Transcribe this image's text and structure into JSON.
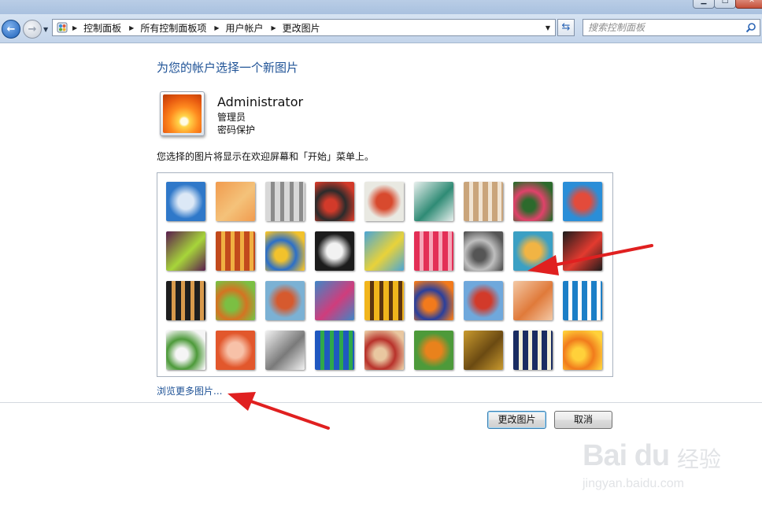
{
  "window": {
    "min_glyph": "▁",
    "max_glyph": "□",
    "close_glyph": "✕"
  },
  "nav": {
    "back_glyph": "←",
    "forward_glyph": "→",
    "recent_glyph": "▼",
    "separator": "▶",
    "breadcrumbs": [
      "控制面板",
      "所有控制面板项",
      "用户帐户",
      "更改图片"
    ],
    "address_dropdown_glyph": "▼",
    "refresh_glyph": "⇆",
    "search_placeholder": "搜索控制面板"
  },
  "main": {
    "title": "为您的帐户选择一个新图片",
    "account": {
      "name": "Administrator",
      "type": "管理员",
      "password_status": "密码保护"
    },
    "description": "您选择的图片将显示在欢迎屏幕和「开始」菜单上。",
    "pictures": [
      {
        "name": "ferris-wheel",
        "colors": [
          "#2f78c9",
          "#dce8f6"
        ]
      },
      {
        "name": "starfish",
        "colors": [
          "#f19b4e",
          "#f4c27a"
        ]
      },
      {
        "name": "robot-toy",
        "colors": [
          "#d8d8d8",
          "#8c8c8c"
        ]
      },
      {
        "name": "record-player",
        "colors": [
          "#2b2b2b",
          "#d23a2a"
        ]
      },
      {
        "name": "lucky-cat",
        "colors": [
          "#e9e9e2",
          "#d84a2e"
        ]
      },
      {
        "name": "gyroscope",
        "colors": [
          "#e9f0ee",
          "#2f8b75"
        ]
      },
      {
        "name": "kitten",
        "colors": [
          "#caa57b",
          "#f1e4d2"
        ]
      },
      {
        "name": "pink-flower",
        "colors": [
          "#e0426a",
          "#2c6a2c"
        ]
      },
      {
        "name": "pinwheel",
        "colors": [
          "#2a8ed8",
          "#e34b3b"
        ]
      },
      {
        "name": "ball",
        "colors": [
          "#5a1d4e",
          "#a7d53a"
        ]
      },
      {
        "name": "woven-fabric",
        "colors": [
          "#c24a1c",
          "#f0b042"
        ]
      },
      {
        "name": "leaf",
        "colors": [
          "#2c6fc7",
          "#f2c22c"
        ]
      },
      {
        "name": "dog",
        "colors": [
          "#1c1c1c",
          "#f2f2f2"
        ]
      },
      {
        "name": "crayons",
        "colors": [
          "#4aa6d6",
          "#e8d23a"
        ]
      },
      {
        "name": "paper-star",
        "colors": [
          "#e32f56",
          "#f6a6b8"
        ]
      },
      {
        "name": "jacks",
        "colors": [
          "#bfbfbf",
          "#555555"
        ]
      },
      {
        "name": "stairs",
        "colors": [
          "#3ba0c4",
          "#f1b444"
        ]
      },
      {
        "name": "paper-crane",
        "colors": [
          "#1c1c1c",
          "#e33a2f"
        ]
      },
      {
        "name": "guitar",
        "colors": [
          "#1e1e1e",
          "#d89a4c"
        ]
      },
      {
        "name": "puppy",
        "colors": [
          "#d47422",
          "#7bbf43"
        ]
      },
      {
        "name": "toy-robot",
        "colors": [
          "#7bb1d4",
          "#d65a2e"
        ]
      },
      {
        "name": "scarf",
        "colors": [
          "#3f86c7",
          "#cf3d7c"
        ]
      },
      {
        "name": "sunflower",
        "colors": [
          "#f1b51c",
          "#5c3410"
        ]
      },
      {
        "name": "fish",
        "colors": [
          "#2a3f9c",
          "#f27a1c"
        ]
      },
      {
        "name": "hot-air-balloon",
        "colors": [
          "#6fa8dc",
          "#d23a2a"
        ]
      },
      {
        "name": "doll",
        "colors": [
          "#f3c9a6",
          "#e07a3a"
        ]
      },
      {
        "name": "sailboat",
        "colors": [
          "#1c7fc7",
          "#ffffff"
        ]
      },
      {
        "name": "soccer-ball",
        "colors": [
          "#4d9a3a",
          "#f5f5f5"
        ]
      },
      {
        "name": "striped-cloth",
        "colors": [
          "#e2572c",
          "#f7c1a8"
        ]
      },
      {
        "name": "marbles",
        "colors": [
          "#f2f2f2",
          "#7a7a7a"
        ]
      },
      {
        "name": "window",
        "colors": [
          "#1f58c0",
          "#2fa84a"
        ]
      },
      {
        "name": "rug",
        "colors": [
          "#b8322b",
          "#e9c7a0"
        ]
      },
      {
        "name": "butterfly",
        "colors": [
          "#4d9a3a",
          "#e9821c"
        ]
      },
      {
        "name": "spiral",
        "colors": [
          "#c99a2e",
          "#6b4a12"
        ]
      },
      {
        "name": "lighthouse",
        "colors": [
          "#1a2c62",
          "#f3f0d8"
        ]
      },
      {
        "name": "orange-flower",
        "colors": [
          "#f17b1c",
          "#ffd13a"
        ]
      }
    ],
    "selected_index": 8,
    "browse_link": "浏览更多图片..."
  },
  "footer": {
    "change_button": "更改图片",
    "cancel_button": "取消"
  },
  "watermark": {
    "brand": "Bai du",
    "cn": "经验",
    "url": "jingyan.baidu.com"
  },
  "colors": {
    "link": "#1e5296",
    "annotation_arrow": "#e02020"
  }
}
